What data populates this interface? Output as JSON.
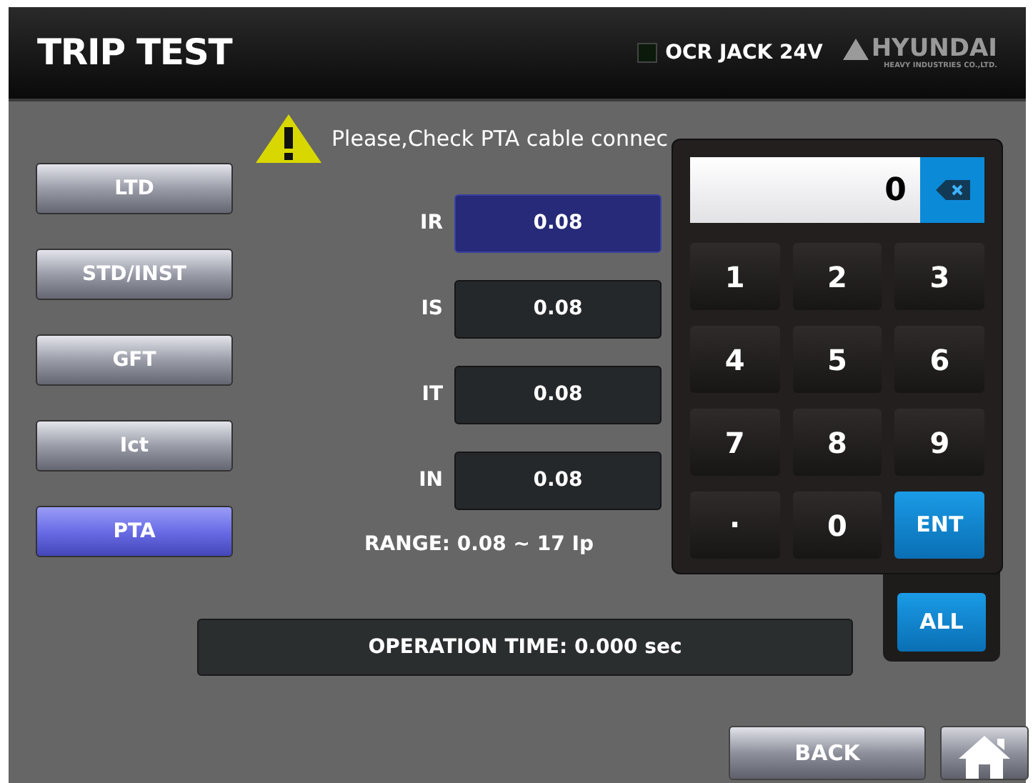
{
  "header": {
    "title": "TRIP TEST",
    "indicator": {
      "label": "OCR JACK 24V",
      "on": false
    },
    "logo": {
      "name": "HYUNDAI",
      "subtitle": "HEAVY INDUSTRIES CO.,LTD."
    }
  },
  "warning": "Please,Check PTA cable connec",
  "modes": [
    {
      "label": "LTD",
      "selected": false
    },
    {
      "label": "STD/INST",
      "selected": false
    },
    {
      "label": "GFT",
      "selected": false
    },
    {
      "label": "Ict",
      "selected": false
    },
    {
      "label": "PTA",
      "selected": true
    }
  ],
  "fields": [
    {
      "label": "IR",
      "value": "0.08",
      "selected": true
    },
    {
      "label": "IS",
      "value": "0.08",
      "selected": false
    },
    {
      "label": "IT",
      "value": "0.08",
      "selected": false
    },
    {
      "label": "IN",
      "value": "0.08",
      "selected": false
    }
  ],
  "range": "RANGE: 0.08 ~ 17 Ip",
  "operation_time": "OPERATION TIME: 0.000 sec",
  "all_button": "ALL",
  "keypad": {
    "display": "0",
    "keys": [
      {
        "label": "1",
        "kind": "digit"
      },
      {
        "label": "2",
        "kind": "digit"
      },
      {
        "label": "3",
        "kind": "digit"
      },
      {
        "label": "4",
        "kind": "digit"
      },
      {
        "label": "5",
        "kind": "digit"
      },
      {
        "label": "6",
        "kind": "digit"
      },
      {
        "label": "7",
        "kind": "digit"
      },
      {
        "label": "8",
        "kind": "digit"
      },
      {
        "label": "9",
        "kind": "digit"
      },
      {
        "label": ".",
        "kind": "point"
      },
      {
        "label": "0",
        "kind": "digit"
      },
      {
        "label": "ENT",
        "kind": "enter"
      }
    ]
  },
  "back_button": "BACK"
}
